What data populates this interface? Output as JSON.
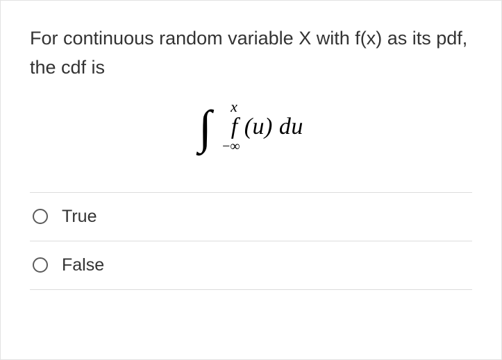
{
  "question": "For continuous random variable X with f(x) as its pdf, the cdf is",
  "formula": {
    "upper": "x",
    "lower": "−∞",
    "body": "f (u) du"
  },
  "options": [
    {
      "label": "True"
    },
    {
      "label": "False"
    }
  ]
}
